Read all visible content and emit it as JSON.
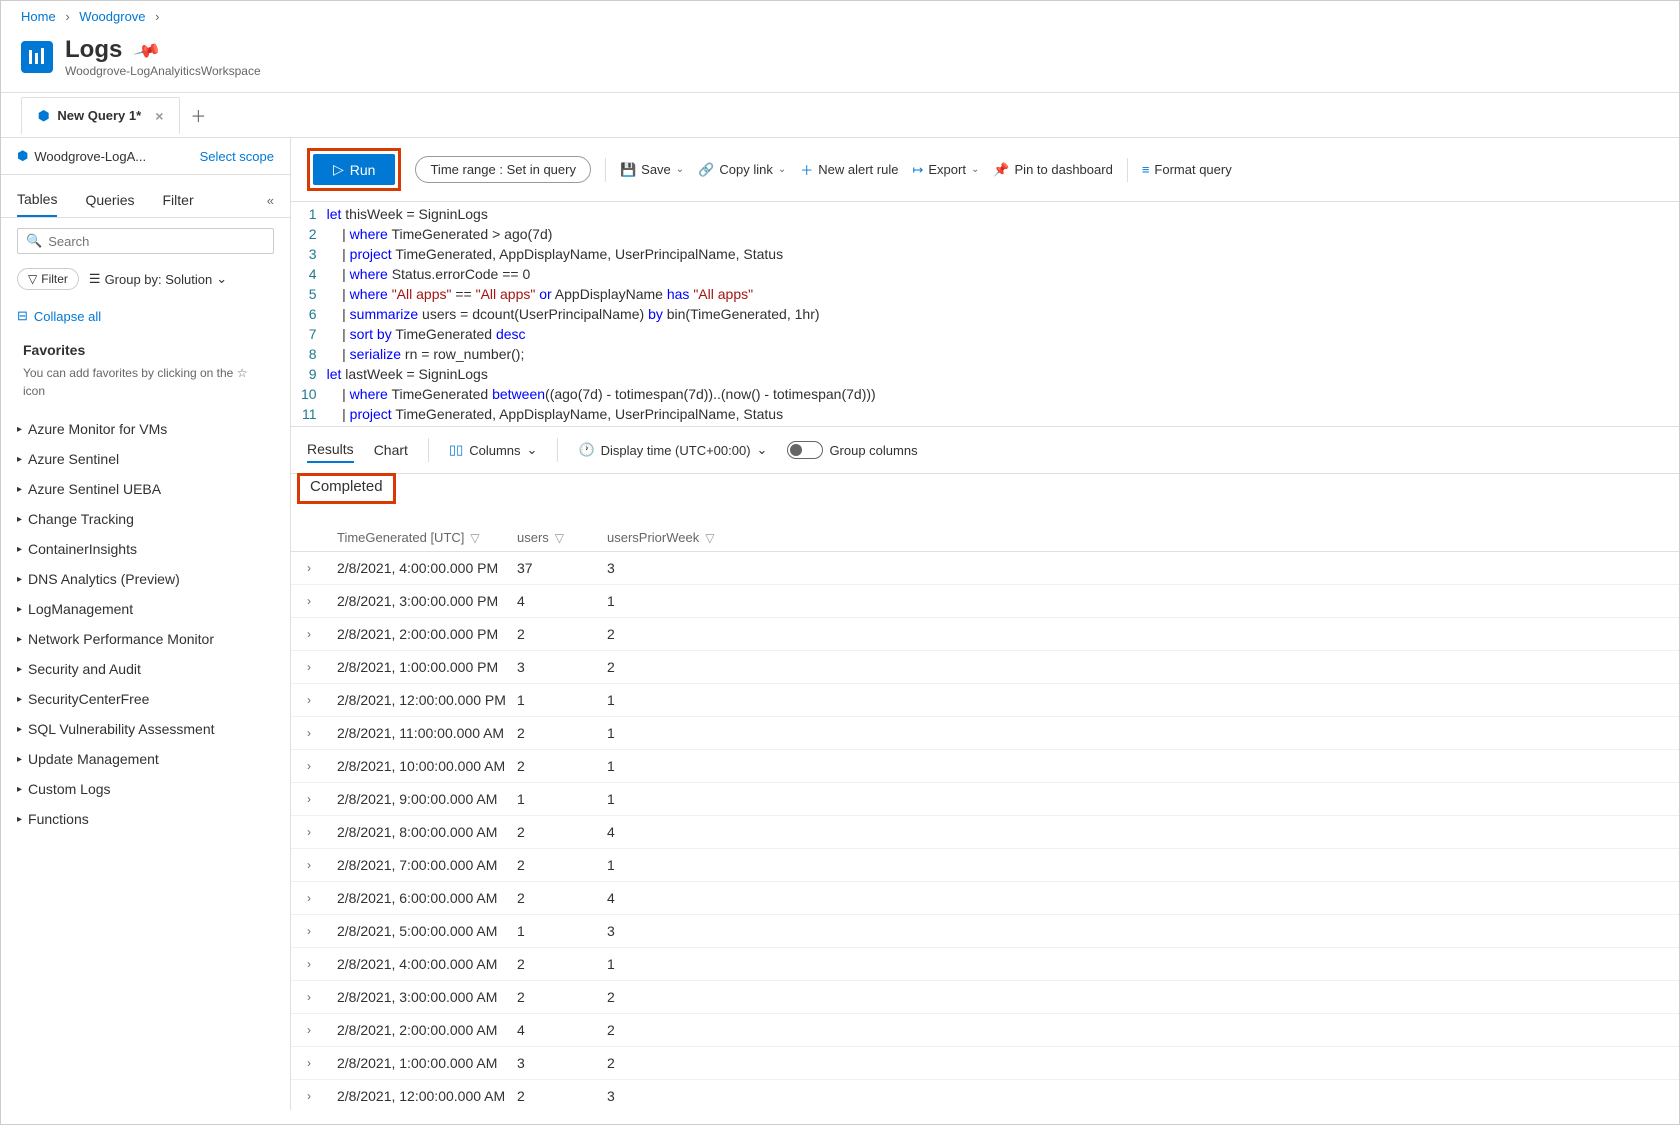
{
  "breadcrumb": {
    "home": "Home",
    "woodgrove": "Woodgrove"
  },
  "header": {
    "title": "Logs",
    "subtitle": "Woodgrove-LogAnalyiticsWorkspace"
  },
  "tab": {
    "label": "New Query 1*"
  },
  "scope": {
    "workspace": "Woodgrove-LogA...",
    "select": "Select scope"
  },
  "sidebar": {
    "tabs": {
      "tables": "Tables",
      "queries": "Queries",
      "filter": "Filter"
    },
    "search_placeholder": "Search",
    "filter_pill": "Filter",
    "groupby": "Group by: Solution",
    "collapse_all": "Collapse all",
    "favorites_head": "Favorites",
    "favorites_hint": "You can add favorites by clicking on the ☆ icon",
    "items": [
      "Azure Monitor for VMs",
      "Azure Sentinel",
      "Azure Sentinel UEBA",
      "Change Tracking",
      "ContainerInsights",
      "DNS Analytics (Preview)",
      "LogManagement",
      "Network Performance Monitor",
      "Security and Audit",
      "SecurityCenterFree",
      "SQL Vulnerability Assessment",
      "Update Management",
      "Custom Logs",
      "Functions"
    ]
  },
  "toolbar": {
    "run": "Run",
    "time_range_label": "Time range :",
    "time_range_value": "Set in query",
    "save": "Save",
    "copy": "Copy link",
    "alert": "New alert rule",
    "export": "Export",
    "pin": "Pin to dashboard",
    "format": "Format query"
  },
  "query_lines": [
    "let thisWeek = SigninLogs",
    "    | where TimeGenerated > ago(7d)",
    "    | project TimeGenerated, AppDisplayName, UserPrincipalName, Status",
    "    | where Status.errorCode == 0",
    "    | where \"All apps\" == \"All apps\" or AppDisplayName has \"All apps\"",
    "    | summarize users = dcount(UserPrincipalName) by bin(TimeGenerated, 1hr)",
    "    | sort by TimeGenerated desc",
    "    | serialize rn = row_number();",
    "let lastWeek = SigninLogs",
    "    | where TimeGenerated between((ago(7d) - totimespan(7d))..(now() - totimespan(7d)))",
    "    | project TimeGenerated, AppDisplayName, UserPrincipalName, Status"
  ],
  "results_bar": {
    "results": "Results",
    "chart": "Chart",
    "columns": "Columns",
    "display_time": "Display time (UTC+00:00)",
    "group_cols": "Group columns"
  },
  "completed": "Completed",
  "columns": {
    "c1": "TimeGenerated [UTC]",
    "c2": "users",
    "c3": "usersPriorWeek"
  },
  "rows": [
    {
      "t": "2/8/2021, 4:00:00.000 PM",
      "u": "37",
      "p": "3"
    },
    {
      "t": "2/8/2021, 3:00:00.000 PM",
      "u": "4",
      "p": "1"
    },
    {
      "t": "2/8/2021, 2:00:00.000 PM",
      "u": "2",
      "p": "2"
    },
    {
      "t": "2/8/2021, 1:00:00.000 PM",
      "u": "3",
      "p": "2"
    },
    {
      "t": "2/8/2021, 12:00:00.000 PM",
      "u": "1",
      "p": "1"
    },
    {
      "t": "2/8/2021, 11:00:00.000 AM",
      "u": "2",
      "p": "1"
    },
    {
      "t": "2/8/2021, 10:00:00.000 AM",
      "u": "2",
      "p": "1"
    },
    {
      "t": "2/8/2021, 9:00:00.000 AM",
      "u": "1",
      "p": "1"
    },
    {
      "t": "2/8/2021, 8:00:00.000 AM",
      "u": "2",
      "p": "4"
    },
    {
      "t": "2/8/2021, 7:00:00.000 AM",
      "u": "2",
      "p": "1"
    },
    {
      "t": "2/8/2021, 6:00:00.000 AM",
      "u": "2",
      "p": "4"
    },
    {
      "t": "2/8/2021, 5:00:00.000 AM",
      "u": "1",
      "p": "3"
    },
    {
      "t": "2/8/2021, 4:00:00.000 AM",
      "u": "2",
      "p": "1"
    },
    {
      "t": "2/8/2021, 3:00:00.000 AM",
      "u": "2",
      "p": "2"
    },
    {
      "t": "2/8/2021, 2:00:00.000 AM",
      "u": "4",
      "p": "2"
    },
    {
      "t": "2/8/2021, 1:00:00.000 AM",
      "u": "3",
      "p": "2"
    },
    {
      "t": "2/8/2021, 12:00:00.000 AM",
      "u": "2",
      "p": "3"
    }
  ]
}
